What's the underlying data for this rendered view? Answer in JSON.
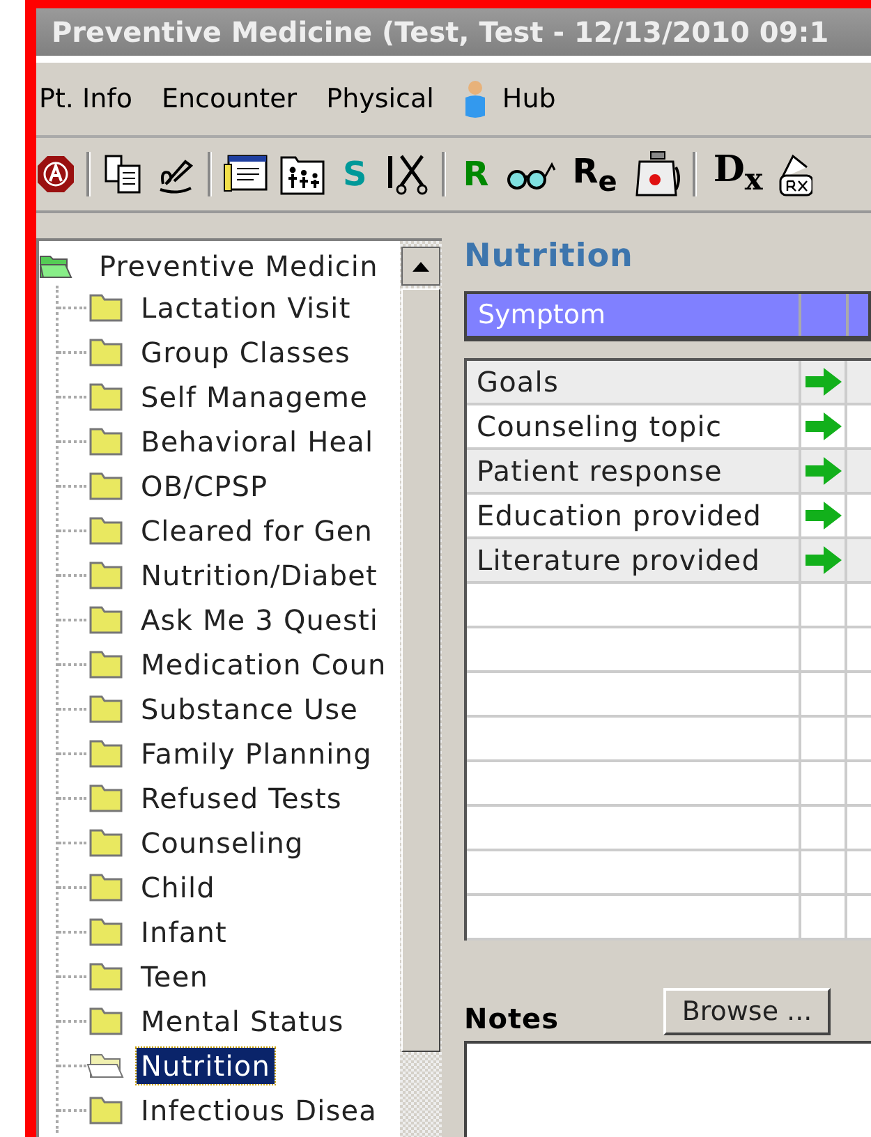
{
  "window": {
    "title": "Preventive Medicine (Test, Test  - 12/13/2010  09:1"
  },
  "menu": [
    {
      "kind": "text",
      "label": "Pt. Info"
    },
    {
      "kind": "text",
      "label": "Encounter"
    },
    {
      "kind": "text",
      "label": "Physical"
    },
    {
      "kind": "person",
      "label": "Hub"
    }
  ],
  "toolbar": [
    {
      "kind": "stop"
    },
    {
      "kind": "sep"
    },
    {
      "kind": "copy"
    },
    {
      "kind": "sign"
    },
    {
      "kind": "sep"
    },
    {
      "kind": "form"
    },
    {
      "kind": "family"
    },
    {
      "kind": "letter",
      "text": "S",
      "color": "#009999"
    },
    {
      "kind": "scissors"
    },
    {
      "kind": "sep"
    },
    {
      "kind": "letter",
      "text": "R",
      "color": "#008800"
    },
    {
      "kind": "glasses"
    },
    {
      "kind": "letter",
      "text": "R$_{e}$",
      "color": "#000000"
    },
    {
      "kind": "bag"
    },
    {
      "kind": "sep"
    },
    {
      "kind": "dx",
      "text": "D$_{x}$"
    },
    {
      "kind": "rx"
    }
  ],
  "tree": {
    "label": "Preventive Medicin",
    "expanded": true,
    "children": [
      {
        "label": "Lactation Visit",
        "selected": false
      },
      {
        "label": "Group Classes",
        "selected": false
      },
      {
        "label": "Self Manageme",
        "selected": false
      },
      {
        "label": "Behavioral Heal",
        "selected": false
      },
      {
        "label": "OB/CPSP",
        "selected": false
      },
      {
        "label": "Cleared for Gen",
        "selected": false
      },
      {
        "label": "Nutrition/Diabet",
        "selected": false
      },
      {
        "label": "Ask Me 3 Questi",
        "selected": false
      },
      {
        "label": "Medication Coun",
        "selected": false
      },
      {
        "label": "Substance Use",
        "selected": false
      },
      {
        "label": "Family Planning",
        "selected": false
      },
      {
        "label": "Refused Tests",
        "selected": false
      },
      {
        "label": "Counseling",
        "selected": false
      },
      {
        "label": "Child",
        "selected": false
      },
      {
        "label": "Infant",
        "selected": false
      },
      {
        "label": "Teen",
        "selected": false
      },
      {
        "label": "Mental Status",
        "selected": false
      },
      {
        "label": "Nutrition",
        "selected": true
      },
      {
        "label": "Infectious Disea",
        "selected": false
      }
    ]
  },
  "panel": {
    "title": "Nutrition",
    "table": {
      "columns": [
        "Symptom"
      ],
      "rows": [
        {
          "symptom": "Goals"
        },
        {
          "symptom": "Counseling topic"
        },
        {
          "symptom": "Patient response"
        },
        {
          "symptom": "Education provided"
        },
        {
          "symptom": "Literature provided"
        }
      ]
    },
    "notes": {
      "label": "Notes",
      "button": "Browse ..."
    }
  }
}
